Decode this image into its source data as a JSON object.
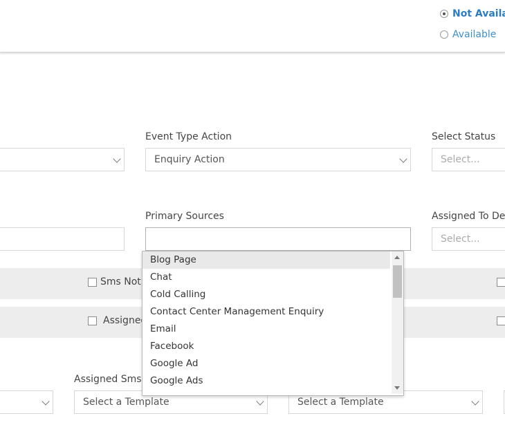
{
  "availability": {
    "not_available": "Not Available",
    "available": "Available",
    "selected": "Not Available"
  },
  "row1": {
    "event_type_action_label": "Event Type Action",
    "event_type_action_value": "Enquiry Action",
    "select_status_label": "Select Status",
    "select_status_placeholder": "Select..."
  },
  "row2": {
    "primary_sources_label": "Primary Sources",
    "primary_sources_value": "",
    "assigned_to_label": "Assigned To Des",
    "assigned_to_placeholder": "Select..."
  },
  "checkboxes": {
    "sms_notification": "Sms Noti",
    "assigned": "Assigned"
  },
  "row3": {
    "assigned_sms_label": "Assigned Sms T",
    "template_placeholder_1": "Select a Template",
    "template_placeholder_2": "Select a Template"
  },
  "primary_sources_options": [
    "Blog Page",
    "Chat",
    "Cold Calling",
    "Contact Center Management Enquiry",
    "Email",
    "Facebook",
    "Google Ad",
    "Google Ads"
  ],
  "colors": {
    "link_blue": "#3d8fd1",
    "band_gray": "#ededed",
    "highlight": "#e9e9e9"
  }
}
